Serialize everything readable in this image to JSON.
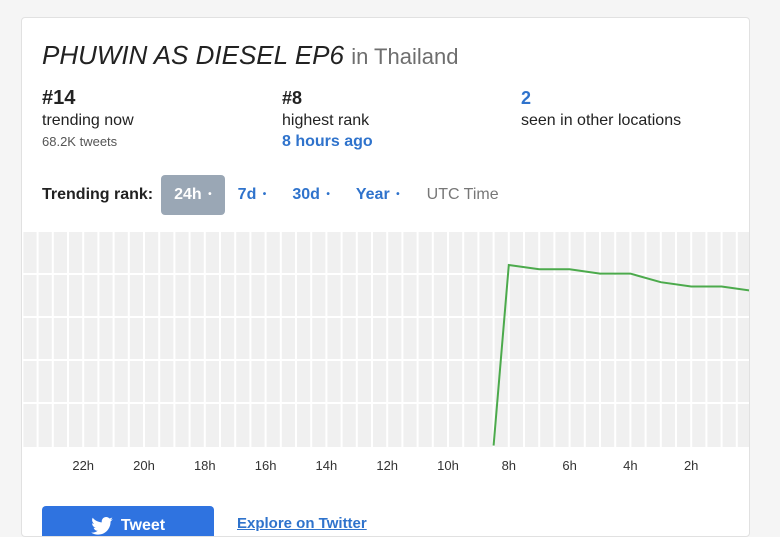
{
  "header": {
    "trend": "PHUWIN AS DIESEL EP6",
    "location": "in Thailand"
  },
  "stats": {
    "current": {
      "value": "#14",
      "label": "trending now",
      "sub": "68.2K tweets"
    },
    "highest": {
      "value": "#8",
      "label": "highest rank",
      "sub": "8 hours ago"
    },
    "other": {
      "value": "2",
      "label": "seen in other locations"
    }
  },
  "rank_controls": {
    "label": "Trending rank:",
    "options": [
      {
        "label": "24h",
        "dot": "•",
        "active": true
      },
      {
        "label": "7d",
        "dot": "•",
        "active": false
      },
      {
        "label": "30d",
        "dot": "•",
        "active": false
      },
      {
        "label": "Year",
        "dot": "•",
        "active": false
      }
    ],
    "utc": "UTC Time"
  },
  "chart_data": {
    "type": "line",
    "x_tick_labels": [
      "22h",
      "20h",
      "18h",
      "16h",
      "14h",
      "12h",
      "10h",
      "8h",
      "6h",
      "4h",
      "2h"
    ],
    "x_hours_ago": [
      8.5,
      8.0,
      7.0,
      6.0,
      5.0,
      4.0,
      3.0,
      2.0,
      1.0,
      0.0
    ],
    "rank": [
      50,
      8,
      9,
      9,
      10,
      10,
      12,
      13,
      13,
      14
    ],
    "y_inverted": true,
    "grid": true,
    "color": "#4caa4c"
  },
  "footer": {
    "tweet_button": "Tweet",
    "explore_link": "Explore on Twitter"
  },
  "colors": {
    "accent": "#2f73cc",
    "active_chip": "#9aa7b5",
    "line": "#4caa4c"
  }
}
